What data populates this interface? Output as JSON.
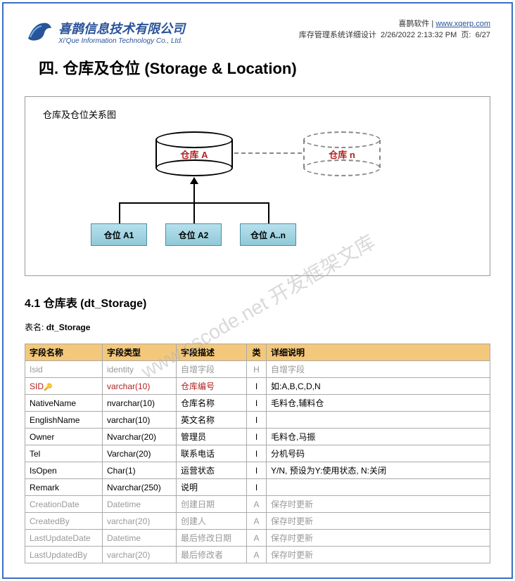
{
  "header": {
    "company_cn": "喜鹊信息技术有限公司",
    "company_en": "Xi'Que Information Technology Co., Ltd.",
    "brand": "喜鹊软件",
    "url": "www.xqerp.com",
    "doc_title": "库存管理系统详细设计",
    "datetime": "2/26/2022 2:13:32 PM",
    "page_label": "页:",
    "page_num": "6/27"
  },
  "title": "四. 仓库及仓位 (Storage & Location)",
  "diagram": {
    "title": "仓库及仓位关系图",
    "storage_a": "仓库 A",
    "storage_n": "仓库 n",
    "loc_a1": "仓位 A1",
    "loc_a2": "仓位 A2",
    "loc_an": "仓位 A..n"
  },
  "watermark": "www.cscode.net 开发框架文库",
  "section": "4.1 仓库表 (dt_Storage)",
  "table_name_label": "表名:",
  "table_name": "dt_Storage",
  "columns": {
    "c1": "字段名称",
    "c2": "字段类型",
    "c3": "字段描述",
    "c4": "类",
    "c5": "详细说明"
  },
  "rows": [
    {
      "name": "Isid",
      "type": "identity",
      "desc": "自增字段",
      "cat": "H",
      "detail": "自增字段",
      "gray": true
    },
    {
      "name": "SID",
      "type": "varchar(10)",
      "desc": "仓库编号",
      "cat": "I",
      "detail": "如:A,B,C,D,N",
      "key": true,
      "red": true
    },
    {
      "name": "NativeName",
      "type": "nvarchar(10)",
      "desc": "仓库名称",
      "cat": "I",
      "detail": "毛料仓,辅料仓"
    },
    {
      "name": "EnglishName",
      "type": "varchar(10)",
      "desc": "英文名称",
      "cat": "I",
      "detail": ""
    },
    {
      "name": "Owner",
      "type": "Nvarchar(20)",
      "desc": "管理员",
      "cat": "I",
      "detail": "毛料仓,马振"
    },
    {
      "name": "Tel",
      "type": "Varchar(20)",
      "desc": "联系电话",
      "cat": "I",
      "detail": "分机号码"
    },
    {
      "name": "IsOpen",
      "type": "Char(1)",
      "desc": "运营状态",
      "cat": "I",
      "detail": "Y/N, 预设为Y:使用状态, N:关闭"
    },
    {
      "name": "Remark",
      "type": "Nvarchar(250)",
      "desc": "说明",
      "cat": "I",
      "detail": ""
    },
    {
      "name": "CreationDate",
      "type": "Datetime",
      "desc": "创建日期",
      "cat": "A",
      "detail": "保存时更新",
      "gray": true
    },
    {
      "name": "CreatedBy",
      "type": "varchar(20)",
      "desc": "创建人",
      "cat": "A",
      "detail": "保存时更新",
      "gray": true
    },
    {
      "name": "LastUpdateDate",
      "type": "Datetime",
      "desc": "最后修改日期",
      "cat": "A",
      "detail": "保存时更新",
      "gray": true
    },
    {
      "name": "LastUpdatedBy",
      "type": "varchar(20)",
      "desc": "最后修改者",
      "cat": "A",
      "detail": "保存时更新",
      "gray": true
    }
  ]
}
